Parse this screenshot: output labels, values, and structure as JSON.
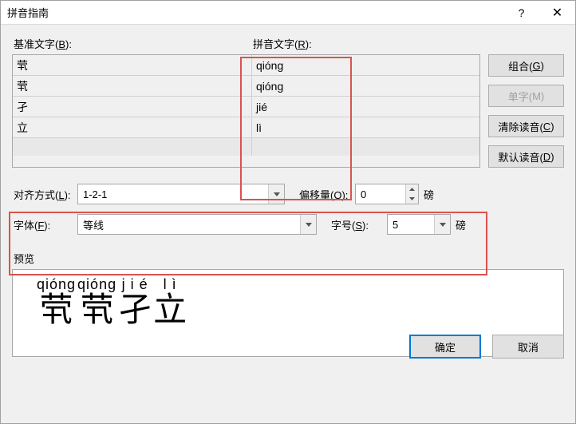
{
  "title": "拼音指南",
  "labels": {
    "base": "基准文字(B):",
    "pinyin": "拼音文字(R):",
    "align": "对齐方式(L):",
    "offset": "偏移量(O):",
    "font": "字体(F):",
    "size": "字号(S):",
    "unit_pt": "磅",
    "preview": "预览"
  },
  "base_u": "B",
  "pinyin_u": "R",
  "align_u": "L",
  "offset_u": "O",
  "font_u": "F",
  "size_u": "S",
  "rows": [
    {
      "base": "茕",
      "pinyin": "qióng"
    },
    {
      "base": "茕",
      "pinyin": "qióng"
    },
    {
      "base": "孑",
      "pinyin": "jié"
    },
    {
      "base": "立",
      "pinyin": "lì"
    }
  ],
  "buttons": {
    "group": "组合(G)",
    "single": "单字(M)",
    "clear": "清除读音(C)",
    "default": "默认读音(D)",
    "ok": "确定",
    "cancel": "取消"
  },
  "group_u": "G",
  "single_u": "M",
  "clear_u": "C",
  "default_u": "D",
  "values": {
    "align": "1-2-1",
    "offset": "0",
    "font": "等线",
    "size": "5"
  },
  "preview": [
    {
      "rt": "qióng",
      "rb": "茕"
    },
    {
      "rt": "qióng",
      "rb": "茕"
    },
    {
      "rt": "j i é",
      "rb": "孑"
    },
    {
      "rt": "l  ì",
      "rb": "立"
    }
  ]
}
